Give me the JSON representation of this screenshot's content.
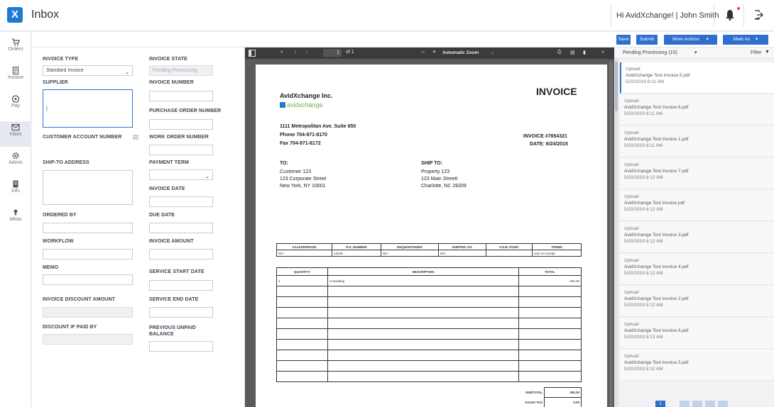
{
  "header": {
    "logo_letter": "X",
    "title": "Inbox",
    "greeting": "Hi AvidXchange! | John Smith"
  },
  "nav": [
    {
      "label": "Orders",
      "icon": "cart-icon"
    },
    {
      "label": "Invoice",
      "icon": "invoice-icon"
    },
    {
      "label": "Pay",
      "icon": "pay-icon"
    },
    {
      "label": "Inbox",
      "icon": "inbox-icon",
      "active": true
    },
    {
      "label": "Admin",
      "icon": "gear-icon"
    },
    {
      "label": "Info",
      "icon": "info-icon"
    },
    {
      "label": "Ideas",
      "icon": "lightbulb-icon"
    }
  ],
  "toolbar": {
    "save": "Save",
    "submit": "Submit",
    "more_actions": "More Actions",
    "mark_as": "Mark As"
  },
  "form": {
    "invoice_type": {
      "label": "INVOICE TYPE",
      "value": "Standard Invoice"
    },
    "invoice_state": {
      "label": "INVOICE STATE",
      "value": "Pending Processing"
    },
    "supplier": {
      "label": "SUPPLIER",
      "value": "|"
    },
    "invoice_number": {
      "label": "INVOICE NUMBER"
    },
    "purchase_order_number": {
      "label": "PURCHASE ORDER NUMBER"
    },
    "customer_account_number": {
      "label": "CUSTOMER ACCOUNT NUMBER"
    },
    "work_order_number": {
      "label": "WORK ORDER NUMBER"
    },
    "ship_to_address": {
      "label": "SHIP-TO ADDRESS"
    },
    "payment_term": {
      "label": "PAYMENT TERM"
    },
    "invoice_date": {
      "label": "INVOICE DATE"
    },
    "ordered_by": {
      "label": "ORDERED BY"
    },
    "due_date": {
      "label": "DUE DATE"
    },
    "workflow": {
      "label": "WORKFLOW"
    },
    "invoice_amount": {
      "label": "INVOICE AMOUNT"
    },
    "memo": {
      "label": "MEMO"
    },
    "service_start_date": {
      "label": "SERVICE START DATE"
    },
    "invoice_discount_amount": {
      "label": "INVOICE DISCOUNT AMOUNT"
    },
    "service_end_date": {
      "label": "SERVICE END DATE"
    },
    "discount_if_paid_by": {
      "label": "DISCOUNT IF PAID BY"
    },
    "previous_unpaid_balance": {
      "label": "PREVIOUS UNPAID BALANCE"
    }
  },
  "viewer": {
    "page_current": "1",
    "page_total": "of 1",
    "zoom": "Automatic Zoom"
  },
  "invoice": {
    "company": "AvidXchange Inc.",
    "brand_logo_text": "avidxchange",
    "title": "INVOICE",
    "address": "1111 Metropolitan Ave. Suite 650",
    "phone": "Phone 704-971-8170",
    "fax": "Fax 704-971-8172",
    "invoice_no": "INVOICE #7654321",
    "date": "DATE: 6/24/2015",
    "to_label": "TO:",
    "to_lines": [
      "Customer 123",
      "123 Corporate Street",
      "New York, NY 10001"
    ],
    "ship_label": "SHIP TO:",
    "ship_lines": [
      "Property 123",
      "123 Main Streett",
      "Charlotte, NC 28209"
    ],
    "meta_headers": [
      "SALESPERSON",
      "P.O. NUMBER",
      "REQUISITIONER",
      "SHIPPED VIA",
      "F.O.B. POINT",
      "TERMS"
    ],
    "meta_values": [
      "N/A",
      "12345",
      "N/A",
      "N/A",
      "",
      "Due on receipt"
    ],
    "item_headers": [
      "QUANTITY",
      "DESCRIPTION",
      "TOTAL"
    ],
    "items": [
      {
        "qty": "1",
        "desc": "Consulting",
        "total": "250.00"
      }
    ],
    "subtotal_label": "SUBTOTAL",
    "subtotal": "250.00",
    "tax_label": "SALES TAX",
    "tax": "0.00"
  },
  "queue": {
    "header": "Pending Processing (10)",
    "filter": "Filter",
    "items": [
      {
        "type": "Upload",
        "name": "AvidXchange Test Invoice 5.pdf",
        "date": "5/20/2019 8:11 AM",
        "selected": true
      },
      {
        "type": "Upload",
        "name": "AvidXchange Test Invoice 6.pdf",
        "date": "5/20/2019 8:11 AM"
      },
      {
        "type": "Upload",
        "name": "AvidXchange Test Invoice 1.pdf",
        "date": "5/20/2019 8:11 AM"
      },
      {
        "type": "Upload",
        "name": "AvidXchange Test Invoice 7.pdf",
        "date": "5/20/2019 8:12 AM"
      },
      {
        "type": "Upload",
        "name": "AvidXchange Test Invoice.pdf",
        "date": "5/20/2019 8:12 AM"
      },
      {
        "type": "Upload",
        "name": "AvidXchange Test Invoice 3.pdf",
        "date": "5/20/2019 8:12 AM"
      },
      {
        "type": "Upload",
        "name": "AvidXchange Test Invoice 4.pdf",
        "date": "5/20/2019 8:12 AM"
      },
      {
        "type": "Upload",
        "name": "AvidXchange Test Invoice 2.pdf",
        "date": "5/20/2019 8:12 AM"
      },
      {
        "type": "Upload",
        "name": "AvidXchange Test Invoice 6.pdf",
        "date": "5/20/2019 8:13 AM"
      },
      {
        "type": "Upload",
        "name": "AvidXchange Test Invoice 5.pdf",
        "date": "5/20/2019 8:12 AM"
      }
    ],
    "pages": [
      "1",
      "2",
      "3",
      "4",
      "5"
    ]
  },
  "colors": {
    "accent": "#2f6fd0",
    "logo": "#1c7bd0"
  }
}
